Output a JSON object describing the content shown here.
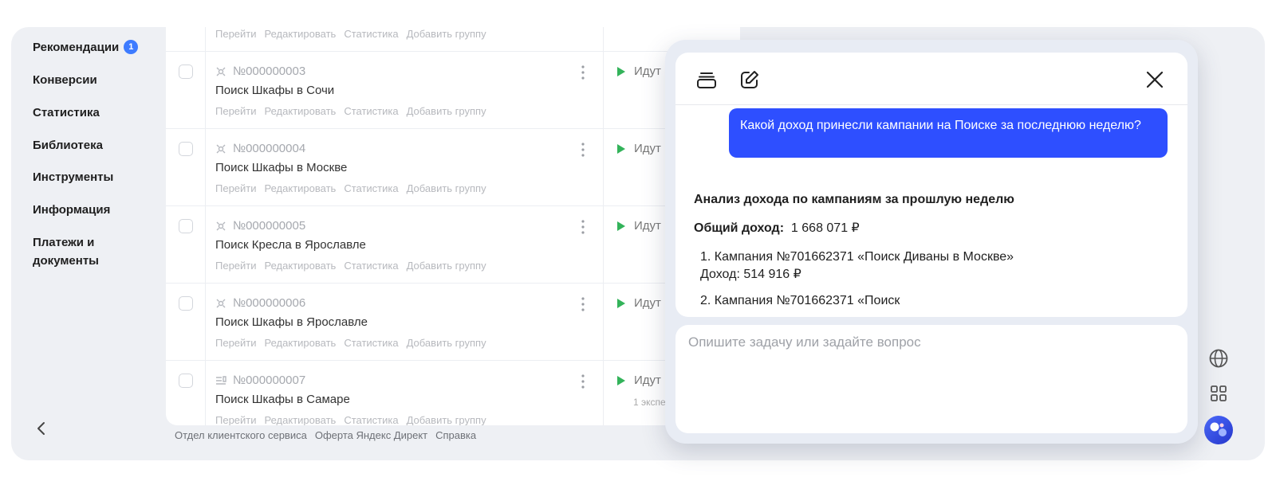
{
  "sidebar": {
    "items": [
      {
        "label": "Рекомендации",
        "badge": "1"
      },
      {
        "label": "Конверсии"
      },
      {
        "label": "Статистика"
      },
      {
        "label": "Библиотека"
      },
      {
        "label": "Инструменты"
      },
      {
        "label": "Информация"
      },
      {
        "label": "Платежи и документы"
      }
    ],
    "collapse_icon": "chevron-left-icon"
  },
  "table": {
    "actions": [
      "Перейти",
      "Редактировать",
      "Статистика",
      "Добавить группу"
    ],
    "rows": [
      {
        "id": "№000000003",
        "name": "Поиск Шкафы в Сочи",
        "status": "Идут",
        "status_sub": ""
      },
      {
        "id": "№000000004",
        "name": "Поиск Шкафы в Москве",
        "status": "Идут",
        "status_sub": ""
      },
      {
        "id": "№000000005",
        "name": "Поиск Кресла в Ярославле",
        "status": "Идут",
        "status_sub": ""
      },
      {
        "id": "№000000006",
        "name": "Поиск Шкафы в Ярославле",
        "status": "Идут",
        "status_sub": ""
      },
      {
        "id": "№000000007",
        "name": "Поиск Шкафы в Самаре",
        "status": "Идут",
        "status_sub": "1 экспе"
      }
    ]
  },
  "footer": {
    "links": [
      "Отдел клиентского сервиса",
      "Оферта Яндекс Директ",
      "Справка"
    ]
  },
  "assistant": {
    "user_message": "Какой доход принесли кампании на Поиске за последнюю неделю?",
    "answer": {
      "heading": "Анализ дохода по кампаниям за прошлую неделю",
      "total_label": "Общий доход:",
      "total_value": "1 668 071 ₽",
      "item1_line1": "1. Кампания №701662371 «Поиск Диваны в Москве»",
      "item1_line2": "Доход: 514 916 ₽",
      "item2_line1": "2. Кампания №701662371 «Поиск"
    },
    "input_placeholder": "Опишите задачу или задайте вопрос"
  },
  "colors": {
    "accent": "#2e4fff",
    "status_play": "#33b35a",
    "badge": "#3d7bff"
  }
}
